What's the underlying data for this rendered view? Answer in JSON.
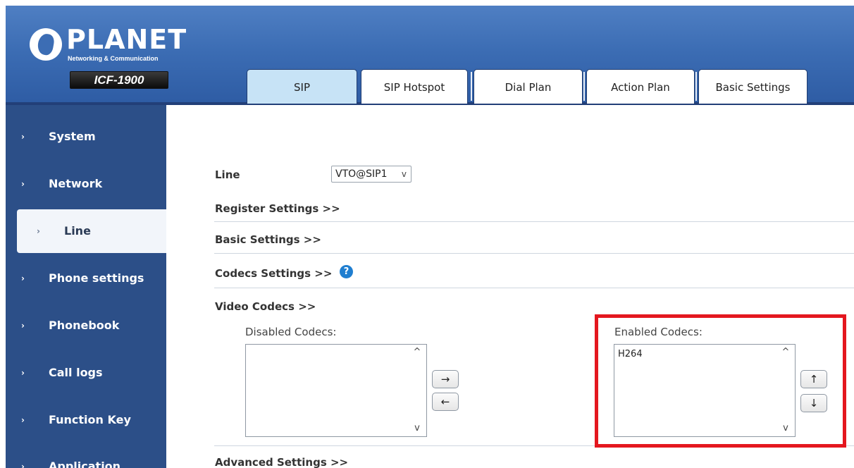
{
  "brand": {
    "logo_text": "PLANET",
    "logo_subtitle": "Networking & Communication",
    "model": "ICF-1900"
  },
  "tabs": [
    {
      "label": "SIP",
      "active": true
    },
    {
      "label": "SIP Hotspot",
      "active": false
    },
    {
      "label": "Dial Plan",
      "active": false
    },
    {
      "label": "Action Plan",
      "active": false
    },
    {
      "label": "Basic Settings",
      "active": false
    }
  ],
  "sidebar": {
    "items": [
      {
        "label": "System",
        "active": false
      },
      {
        "label": "Network",
        "active": false
      },
      {
        "label": "Line",
        "active": true
      },
      {
        "label": "Phone settings",
        "active": false
      },
      {
        "label": "Phonebook",
        "active": false
      },
      {
        "label": "Call logs",
        "active": false
      },
      {
        "label": "Function Key",
        "active": false
      },
      {
        "label": "Application",
        "active": false
      }
    ],
    "chevron": "›"
  },
  "content": {
    "line_label": "Line",
    "line_value": "VTO@SIP1",
    "register_settings": "Register Settings >>",
    "basic_settings": "Basic Settings >>",
    "codecs_settings": "Codecs Settings >>",
    "help_glyph": "?",
    "video_codecs": "Video Codecs >>",
    "disabled_codecs_title": "Disabled Codecs:",
    "enabled_codecs_title": "Enabled Codecs:",
    "enabled_codecs": [
      "H264"
    ],
    "advanced_settings": "Advanced Settings >>",
    "buttons": {
      "move_right": "→",
      "move_left": "←",
      "move_up": "↑",
      "move_down": "↓"
    }
  },
  "icons": {
    "scroll_up": "^",
    "scroll_down": "v",
    "select_caret": "v"
  },
  "colors": {
    "header_blue": "#3c6db4",
    "sidebar_blue": "#2c4f88",
    "active_tab": "#c7e3f6",
    "highlight_red": "#e4171f"
  }
}
